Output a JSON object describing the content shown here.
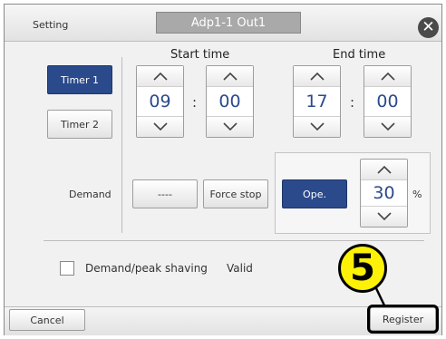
{
  "header": {
    "setting_label": "Setting",
    "title": "Adp1-1 Out1",
    "close_icon": "close-icon"
  },
  "timers": {
    "start_time_label": "Start time",
    "end_time_label": "End time",
    "timer1_label": "Timer 1",
    "timer2_label": "Timer 2",
    "start_hour": "09",
    "start_minute": "00",
    "end_hour": "17",
    "end_minute": "00",
    "separator": ":"
  },
  "demand": {
    "label": "Demand",
    "dash_button": "----",
    "force_stop_button": "Force stop",
    "ope_button": "Ope.",
    "percent_value": "30",
    "percent_unit": "%"
  },
  "peak_shaving": {
    "label": "Demand/peak shaving",
    "status": "Valid",
    "checked": false
  },
  "footer": {
    "cancel_label": "Cancel",
    "register_label": "Register"
  },
  "annotation": {
    "step_number": "5"
  },
  "colors": {
    "accent_blue": "#2b4a8c",
    "annotation_yellow": "#fcf107"
  }
}
